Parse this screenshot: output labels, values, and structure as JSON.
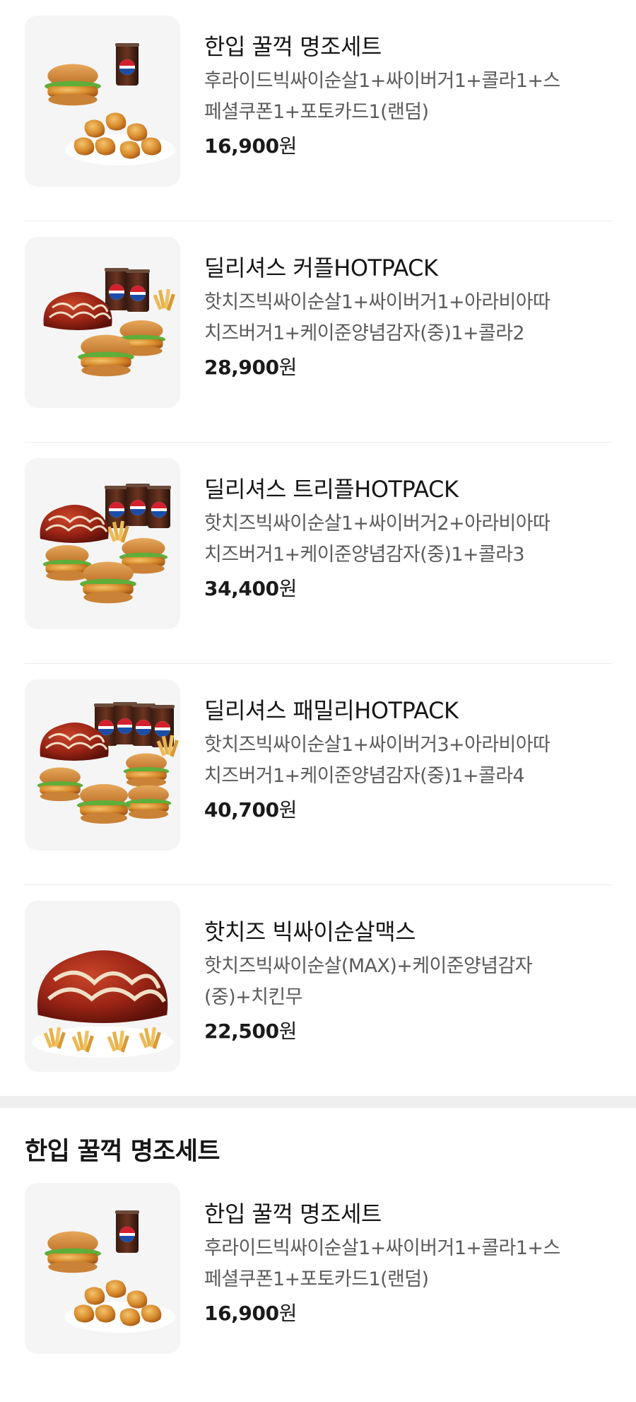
{
  "menu_items": [
    {
      "name": "한입 꿀꺽 명조세트",
      "desc_line1": "후라이드빅싸이순살1+싸이버거1+콜라1+스",
      "desc_line2": "페셜쿠폰1+포토카드1(랜덤)",
      "price": "16,900",
      "currency": "원",
      "image_icon": "fried-chicken-burger-set-image"
    },
    {
      "name": "딜리셔스 커플HOTPACK",
      "desc_line1": "핫치즈빅싸이순살1+싸이버거1+아라비아따",
      "desc_line2": "치즈버거1+케이준양념감자(중)1+콜라2",
      "price": "28,900",
      "currency": "원",
      "image_icon": "couple-hotpack-image"
    },
    {
      "name": "딜리셔스 트리플HOTPACK",
      "desc_line1": "핫치즈빅싸이순살1+싸이버거2+아라비아따",
      "desc_line2": "치즈버거1+케이준양념감자(중)1+콜라3",
      "price": "34,400",
      "currency": "원",
      "image_icon": "triple-hotpack-image"
    },
    {
      "name": "딜리셔스 패밀리HOTPACK",
      "desc_line1": "핫치즈빅싸이순살1+싸이버거3+아라비아따",
      "desc_line2": "치즈버거1+케이준양념감자(중)1+콜라4",
      "price": "40,700",
      "currency": "원",
      "image_icon": "family-hotpack-image"
    },
    {
      "name": "핫치즈 빅싸이순살맥스",
      "desc_line1": "핫치즈빅싸이순살(MAX)+케이준양념감자",
      "desc_line2": "(중)+치킨무",
      "price": "22,500",
      "currency": "원",
      "image_icon": "spicy-chicken-fries-image"
    }
  ],
  "section": {
    "title": "한입 꿀꺽 명조세트",
    "items": [
      {
        "name": "한입 꿀꺽 명조세트",
        "desc_line1": "후라이드빅싸이순살1+싸이버거1+콜라1+스",
        "desc_line2": "페셜쿠폰1+포토카드1(랜덤)",
        "price": "16,900",
        "currency": "원",
        "image_icon": "fried-chicken-burger-set-image"
      }
    ]
  },
  "drink_brand_text": "PEPSI",
  "colors": {
    "background": "#ffffff",
    "thumbnail_bg": "#f5f5f5",
    "divider": "#ececec",
    "section_gap": "#efefef",
    "description_text": "#5b5b5b",
    "title_text": "#161616"
  }
}
